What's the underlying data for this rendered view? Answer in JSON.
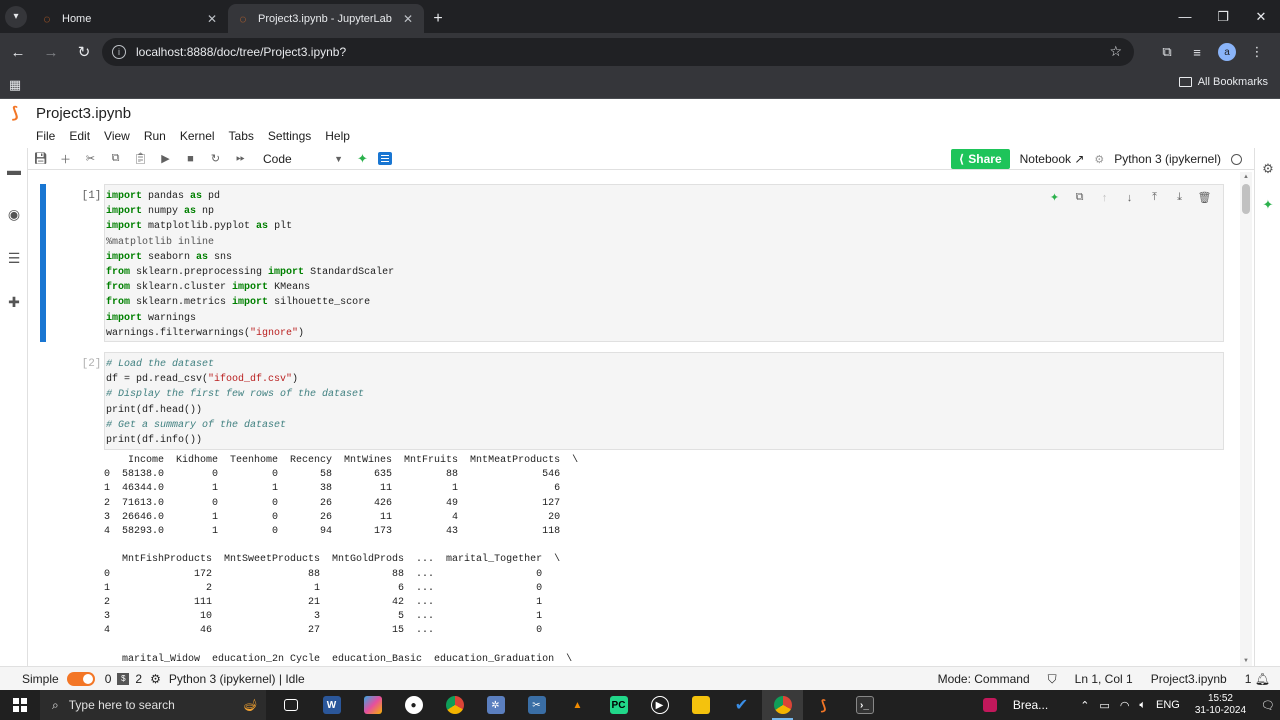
{
  "browser": {
    "tabs": [
      {
        "title": "Home",
        "active": false
      },
      {
        "title": "Project3.ipynb - JupyterLab",
        "active": true
      }
    ],
    "url": "localhost:8888/doc/tree/Project3.ipynb?",
    "profile_initial": "a",
    "bookmarks_label": "All Bookmarks"
  },
  "jupyter": {
    "notebook_title": "Project3.ipynb",
    "menu": [
      "File",
      "Edit",
      "View",
      "Run",
      "Kernel",
      "Tabs",
      "Settings",
      "Help"
    ],
    "cell_type": "Code",
    "share_label": "Share",
    "notebook_label": "Notebook",
    "kernel_label": "Python 3 (ipykernel)"
  },
  "cells": {
    "cell1": {
      "prompt": "[1]:",
      "lines": [
        [
          [
            "kw",
            "import"
          ],
          [
            "",
            " pandas "
          ],
          [
            "kw",
            "as"
          ],
          [
            "",
            " pd"
          ]
        ],
        [
          [
            "kw",
            "import"
          ],
          [
            "",
            " numpy "
          ],
          [
            "kw",
            "as"
          ],
          [
            "",
            " np"
          ]
        ],
        [
          [
            "kw",
            "import"
          ],
          [
            "",
            " matplotlib.pyplot "
          ],
          [
            "kw",
            "as"
          ],
          [
            "",
            " plt"
          ]
        ],
        [
          [
            "magic",
            "%matplotlib inline"
          ]
        ],
        [
          [
            "kw",
            "import"
          ],
          [
            "",
            " seaborn "
          ],
          [
            "kw",
            "as"
          ],
          [
            "",
            " sns"
          ]
        ],
        [
          [
            "kw",
            "from"
          ],
          [
            "",
            " sklearn.preprocessing "
          ],
          [
            "kw",
            "import"
          ],
          [
            "",
            " StandardScaler"
          ]
        ],
        [
          [
            "kw",
            "from"
          ],
          [
            "",
            " sklearn.cluster "
          ],
          [
            "kw",
            "import"
          ],
          [
            "",
            " KMeans"
          ]
        ],
        [
          [
            "kw",
            "from"
          ],
          [
            "",
            " sklearn.metrics "
          ],
          [
            "kw",
            "import"
          ],
          [
            "",
            " silhouette_score"
          ]
        ],
        [
          [
            "kw",
            "import"
          ],
          [
            "",
            " warnings"
          ]
        ],
        [
          [
            "",
            "warnings.filterwarnings("
          ],
          [
            "str",
            "\"ignore\""
          ],
          [
            "",
            ")"
          ]
        ]
      ]
    },
    "cell2": {
      "prompt": "[2]:",
      "lines": [
        [
          [
            "cm",
            "# Load the dataset"
          ]
        ],
        [
          [
            "",
            "df = pd.read_csv("
          ],
          [
            "str",
            "\"ifood_df.csv\""
          ],
          [
            "",
            ")"
          ]
        ],
        [
          [
            "cm",
            "# Display the first few rows of the dataset"
          ]
        ],
        [
          [
            "",
            "print(df.head())"
          ]
        ],
        [
          [
            "cm",
            "# Get a summary of the dataset"
          ]
        ],
        [
          [
            "",
            "print(df.info())"
          ]
        ]
      ],
      "output": "    Income  Kidhome  Teenhome  Recency  MntWines  MntFruits  MntMeatProducts  \\\n0  58138.0        0         0       58       635         88              546   \n1  46344.0        1         1       38        11          1                6   \n2  71613.0        0         0       26       426         49              127   \n3  26646.0        1         0       26        11          4               20   \n4  58293.0        1         0       94       173         43              118   \n\n   MntFishProducts  MntSweetProducts  MntGoldProds  ...  marital_Together  \\\n0              172                88            88  ...                 0   \n1                2                 1             6  ...                 0   \n2              111                21            42  ...                 1   \n3               10                 3             5  ...                 1   \n4               46                27            15  ...                 0   \n\n   marital_Widow  education_2n Cycle  education_Basic  education_Graduation  \\"
    }
  },
  "statusbar": {
    "mode_label": "Simple",
    "terminals": "0",
    "kernels": "2",
    "kernel_status": "Python 3 (ipykernel) | Idle",
    "mode": "Mode: Command",
    "cursor": "Ln 1, Col 1",
    "file": "Project3.ipynb",
    "count": "1"
  },
  "taskbar": {
    "search_placeholder": "Type here to search",
    "news": "Brea...",
    "lang": "ENG",
    "time": "15:52",
    "date": "31-10-2024"
  },
  "colors": {
    "accent_blue": "#1976d2",
    "jupyter_orange": "#f37626",
    "share_green": "#1ec45a"
  }
}
